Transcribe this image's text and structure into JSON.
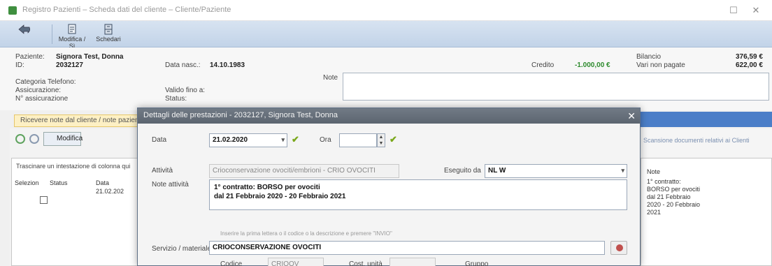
{
  "window": {
    "title": "Registro Pazienti – Scheda dati del cliente – Cliente/Paziente",
    "minimize": "☐",
    "close": "✕"
  },
  "toolbar": {
    "buttons": [
      {
        "label": "",
        "icon": "back-arrow-icon"
      },
      {
        "label": "Modifica / Sì",
        "icon": "document-edit-icon"
      },
      {
        "label": "Schedari",
        "icon": "file-cabinet-icon"
      }
    ]
  },
  "patient": {
    "patient_label": "Paziente:",
    "patient_name": "Signora Test, Donna",
    "id_label": "ID:",
    "id_value": "2032127",
    "birth_label": "Data nasc.:",
    "birth_value": "14.10.1983",
    "phone_label": "Categoria Telefono:",
    "doctor_label": "Assicurazione:",
    "card_label": "N° assicurazione",
    "valid_label": "Valido fino a:",
    "status_label": "Status:",
    "credit_label": "Credito",
    "credit_value": "-1.000,00 €",
    "unpaid_label": "Vari non pagate",
    "balance_label": "Bilancio",
    "balance_value": "376,59 €",
    "unpaid_value": "622,00 €",
    "note_label": "Note"
  },
  "infobar": {
    "text": "Ricevere note dal cliente / note paziente"
  },
  "left": {
    "modify_label": "Modifica",
    "grid_note": "Trascinare un intestazione di colonna qui",
    "col_select": "Selezion",
    "col_status": "Status",
    "col_date": "Data",
    "row_date": "21.02.202"
  },
  "right": {
    "link": "Scansione documenti relativi ai Clienti",
    "note_header": "Note",
    "note_text": "1° contratto: BORSO per ovociti dal 21 Febbraio 2020 - 20 Febbraio 2021"
  },
  "dialog": {
    "title": "Dettagli delle prestazioni - 2032127, Signora Test, Donna",
    "close": "✕",
    "date_label": "Data",
    "date_value": "21.02.2020",
    "time_label": "Ora",
    "time_value": "",
    "activity_label": "Attività",
    "activity_value": "Crioconservazione ovociti/embrioni - CRIO OVOCITI",
    "performed_label": "Eseguito da",
    "performed_value": "NL W",
    "note_label": "Note attività",
    "note_line1": "1° contratto: BORSO per ovociti",
    "note_line2": "dal 21 Febbraio 2020 - 20 Febbraio 2021",
    "hint": "Inserire la prima lettera o il codice o la descrizione e premere \"INVIO\"",
    "service_label": "Servizio / materiale",
    "service_value": "CRIOCONSERVAZIONE OVOCITI",
    "code_label": "Codice",
    "code_value": "CRIOOV",
    "cost_label": "Cost. unità",
    "group_label": "Gruppo"
  }
}
